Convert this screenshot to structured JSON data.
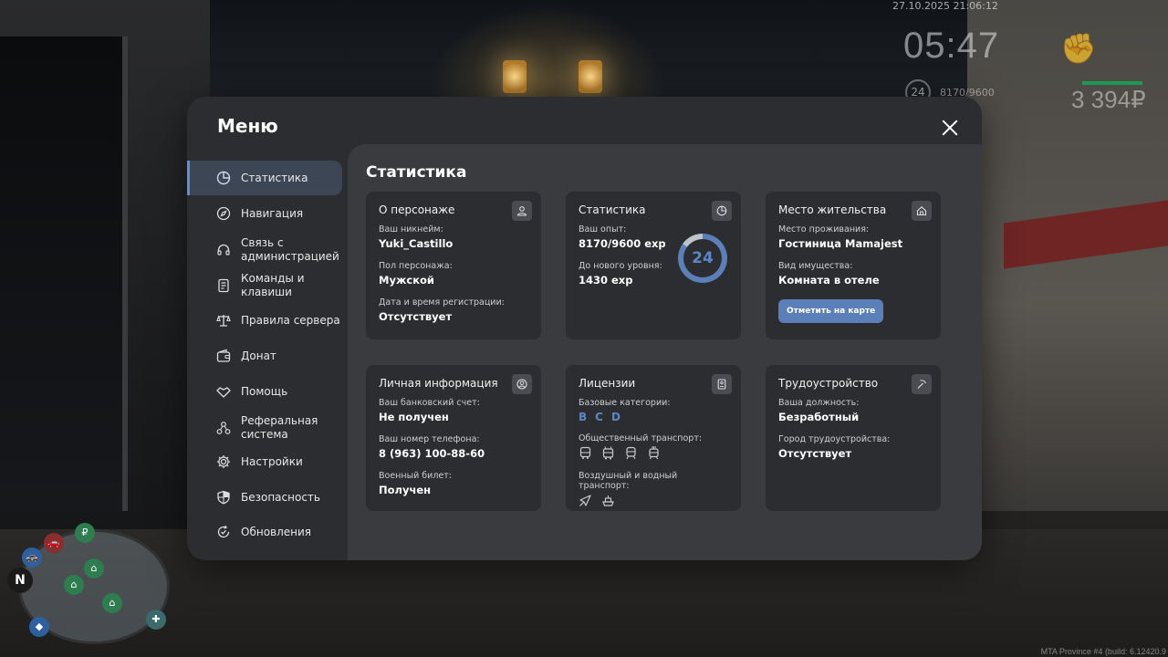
{
  "hud": {
    "datetime": "27.10.2025 21:06:12",
    "clock": "05:47",
    "level": "24",
    "exp": "8170/9600",
    "money": "3 394₽",
    "build": "MTA Province #4 (build: 6.12420.9"
  },
  "minimap": {
    "compass": "N"
  },
  "modal": {
    "title": "Меню",
    "close_label": "close"
  },
  "sidebar": {
    "items": [
      {
        "label": "Статистика",
        "icon": "pie-chart-icon",
        "active": true
      },
      {
        "label": "Навигация",
        "icon": "compass-icon"
      },
      {
        "label": "Связь с администрацией",
        "icon": "headset-icon"
      },
      {
        "label": "Команды и клавиши",
        "icon": "document-icon"
      },
      {
        "label": "Правила сервера",
        "icon": "scales-icon"
      },
      {
        "label": "Донат",
        "icon": "wallet-icon"
      },
      {
        "label": "Помощь",
        "icon": "handshake-icon"
      },
      {
        "label": "Реферальная система",
        "icon": "network-icon"
      },
      {
        "label": "Настройки",
        "icon": "gear-icon"
      },
      {
        "label": "Безопасность",
        "icon": "shield-icon"
      },
      {
        "label": "Обновления",
        "icon": "refresh-check-icon"
      }
    ]
  },
  "content": {
    "title": "Статистика",
    "character": {
      "title": "О персонаже",
      "icon": "user-icon",
      "nickname_label": "Ваш никнейм:",
      "nickname": "Yuki_Castillo",
      "gender_label": "Пол персонажа:",
      "gender": "Мужской",
      "regdate_label": "Дата и время регистрации:",
      "regdate": "Отсутствует"
    },
    "stats": {
      "title": "Статистика",
      "icon": "pie-chart-icon",
      "exp_label": "Ваш опыт:",
      "exp": "8170/9600 exp",
      "next_label": "До нового уровня:",
      "next": "1430 exp",
      "level": "24",
      "level_progress_percent": 85
    },
    "residence": {
      "title": "Место жительства",
      "icon": "home-icon",
      "place_label": "Место проживания:",
      "place": "Гостиница Mamajest",
      "property_label": "Вид имущества:",
      "property": "Комната в отеле",
      "map_button": "Отметить на карте"
    },
    "personal": {
      "title": "Личная информация",
      "icon": "user-circle-icon",
      "bank_label": "Ваш банковский счет:",
      "bank": "Не получен",
      "phone_label": "Ваш номер телефона:",
      "phone": "8 (963) 100-88-60",
      "military_label": "Военный билет:",
      "military": "Получен"
    },
    "licenses": {
      "title": "Лицензии",
      "icon": "id-card-icon",
      "base_label": "Базовые категории:",
      "categories": [
        "B",
        "C",
        "D"
      ],
      "public_label": "Общественный транспорт:",
      "public_icons": [
        "bus-icon",
        "trolleybus-icon",
        "train-icon",
        "tram-icon"
      ],
      "air_label": "Воздушный и водный транспорт:",
      "air_icons": [
        "plane-icon",
        "ship-icon"
      ]
    },
    "job": {
      "title": "Трудоустройство",
      "icon": "pickaxe-icon",
      "position_label": "Ваша должность:",
      "position": "Безработный",
      "city_label": "Город трудоустройства:",
      "city": "Отсутствует"
    }
  }
}
